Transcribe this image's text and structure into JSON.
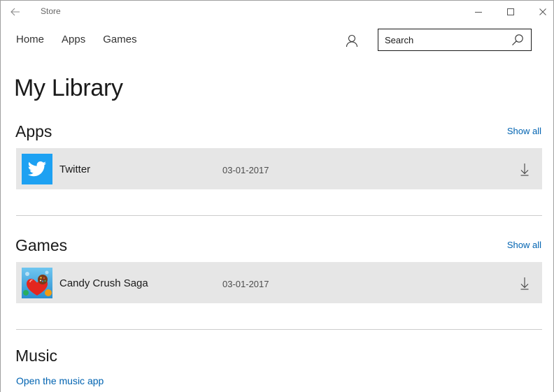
{
  "window": {
    "title": "Store"
  },
  "nav": {
    "items": [
      {
        "label": "Home"
      },
      {
        "label": "Apps"
      },
      {
        "label": "Games"
      }
    ]
  },
  "search": {
    "placeholder": "Search",
    "value": ""
  },
  "page": {
    "title": "My Library"
  },
  "sections": {
    "apps": {
      "title": "Apps",
      "show_all": "Show all",
      "items": [
        {
          "name": "Twitter",
          "date": "03-01-2017",
          "icon": "twitter-icon"
        }
      ]
    },
    "games": {
      "title": "Games",
      "show_all": "Show all",
      "items": [
        {
          "name": "Candy Crush Saga",
          "date": "03-01-2017",
          "icon": "candy-crush-icon"
        }
      ]
    },
    "music": {
      "title": "Music",
      "link": "Open the music app"
    }
  },
  "colors": {
    "accent": "#0063b1",
    "twitter": "#1da1f2",
    "row_bg": "#e6e6e6"
  }
}
